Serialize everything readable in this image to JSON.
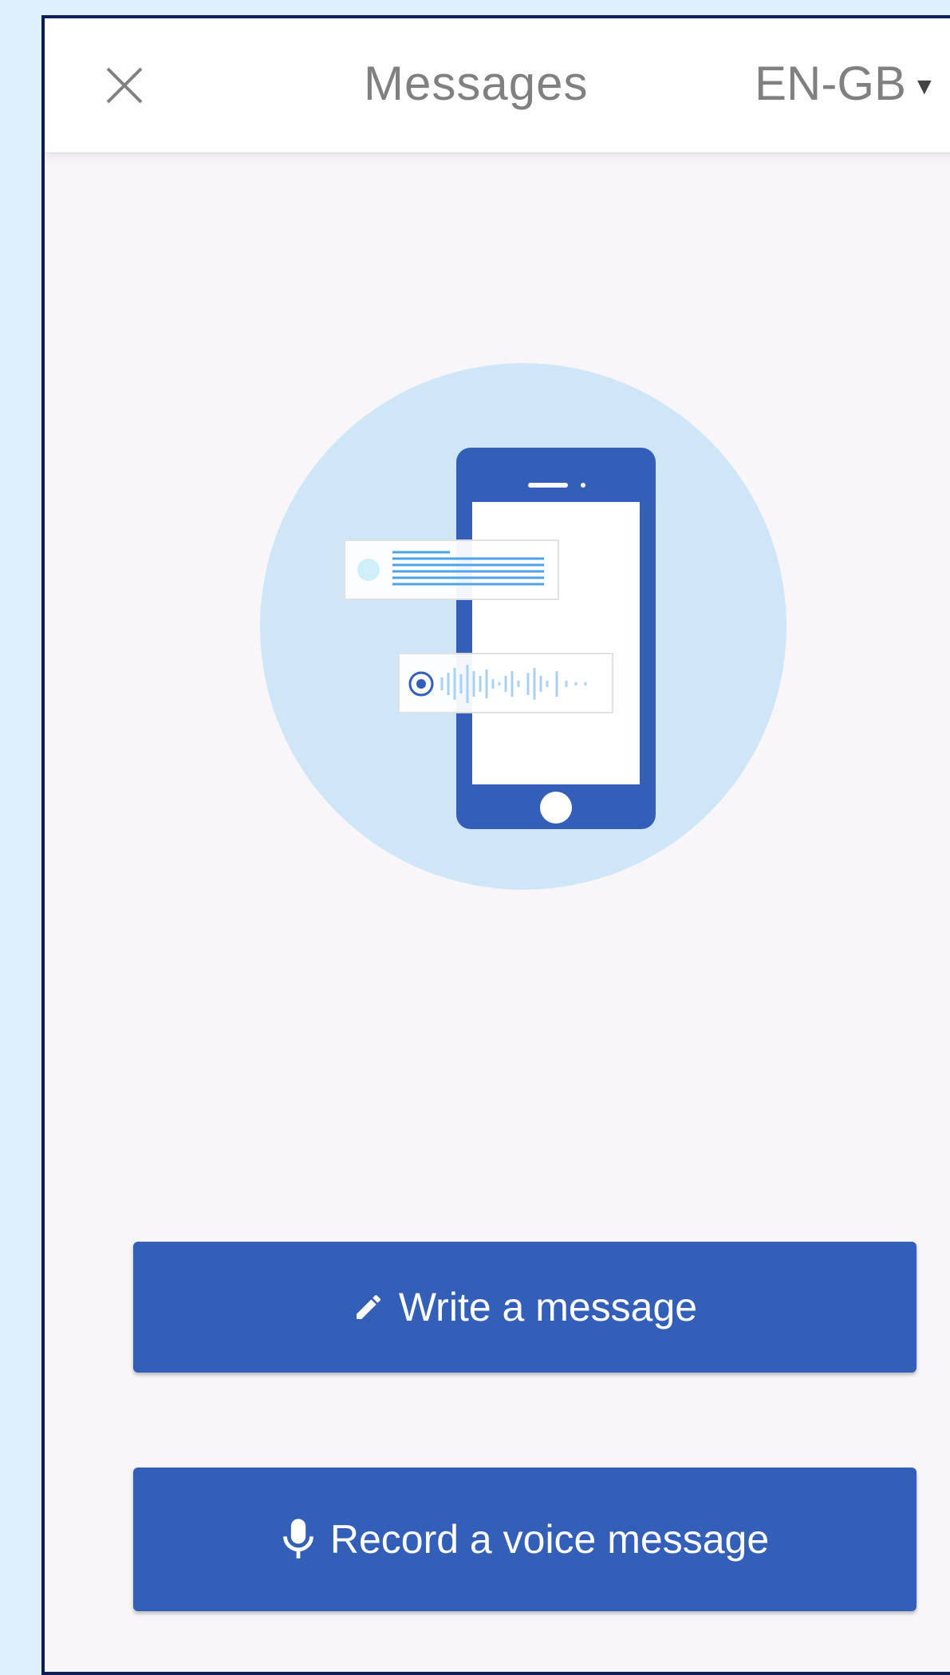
{
  "header": {
    "title": "Messages",
    "language": "EN-GB",
    "close_icon": "close-icon",
    "dropdown_icon": "caret-down-icon"
  },
  "illustration": {
    "icon": "phone-message-illustration"
  },
  "actions": {
    "write_label": "Write a message",
    "write_icon": "pencil-icon",
    "voice_label": "Record a voice message",
    "voice_icon": "microphone-icon"
  },
  "colors": {
    "primary": "#335fb9",
    "circle": "#cfe6f8",
    "page_bg": "#dff0fd",
    "border": "#0b1e57"
  }
}
